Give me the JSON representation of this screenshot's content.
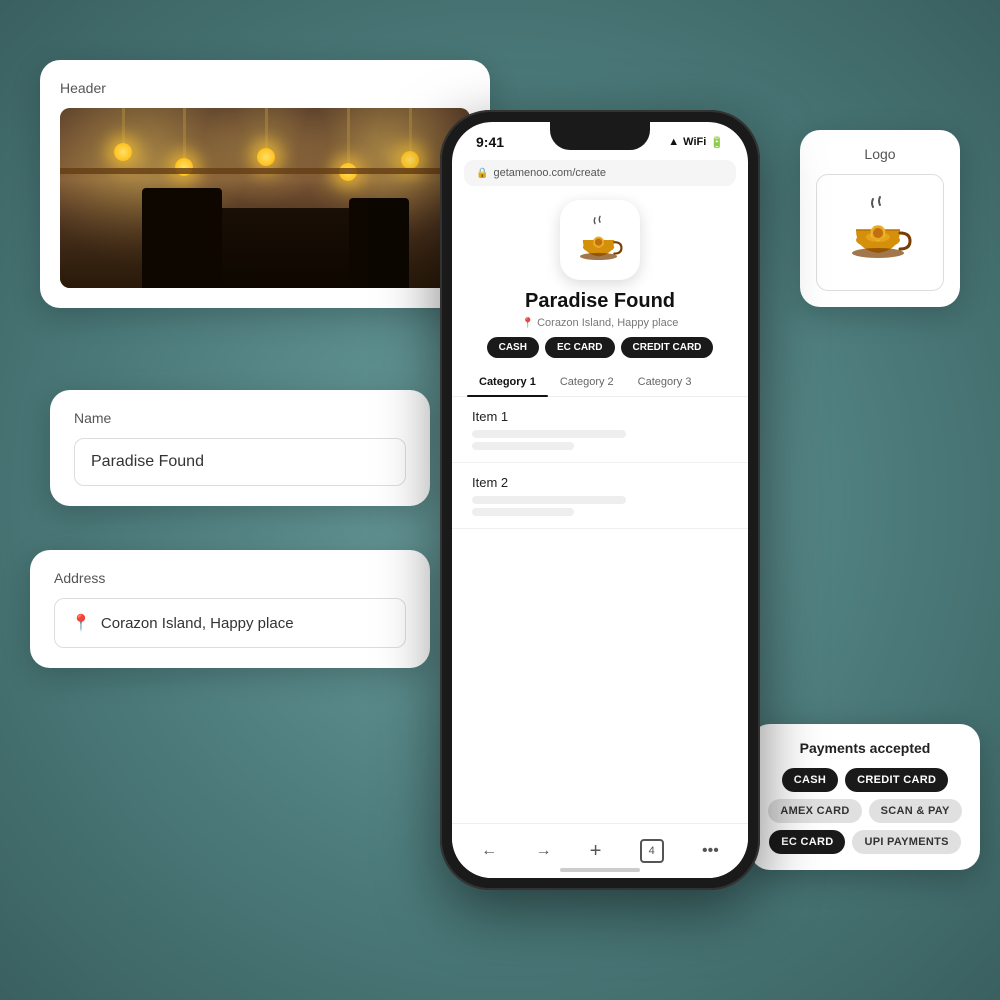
{
  "header_card": {
    "label": "Header"
  },
  "name_card": {
    "label": "Name",
    "value": "Paradise Found"
  },
  "address_card": {
    "label": "Address",
    "value": "Corazon Island, Happy place"
  },
  "logo_card": {
    "label": "Logo"
  },
  "payments_card": {
    "title": "Payments accepted",
    "tags": [
      {
        "label": "CASH",
        "style": "dark"
      },
      {
        "label": "CREDIT CARD",
        "style": "dark"
      },
      {
        "label": "AMEX CARD",
        "style": "gray"
      },
      {
        "label": "SCAN & PAY",
        "style": "gray"
      },
      {
        "label": "EC CARD",
        "style": "dark"
      },
      {
        "label": "UPI PAYMENTS",
        "style": "gray"
      }
    ]
  },
  "phone": {
    "time": "9:41",
    "url": "getamenoo.com/create",
    "restaurant_name": "Paradise Found",
    "address": "Corazon Island, Happy place",
    "payment_tags": [
      "CASH",
      "EC CARD",
      "CREDIT CARD"
    ],
    "categories": [
      "Category 1",
      "Category 2",
      "Category 3"
    ],
    "items": [
      {
        "name": "Item 1"
      },
      {
        "name": "Item 2"
      }
    ],
    "nav": [
      "←",
      "→",
      "+",
      "4",
      "•••"
    ]
  }
}
